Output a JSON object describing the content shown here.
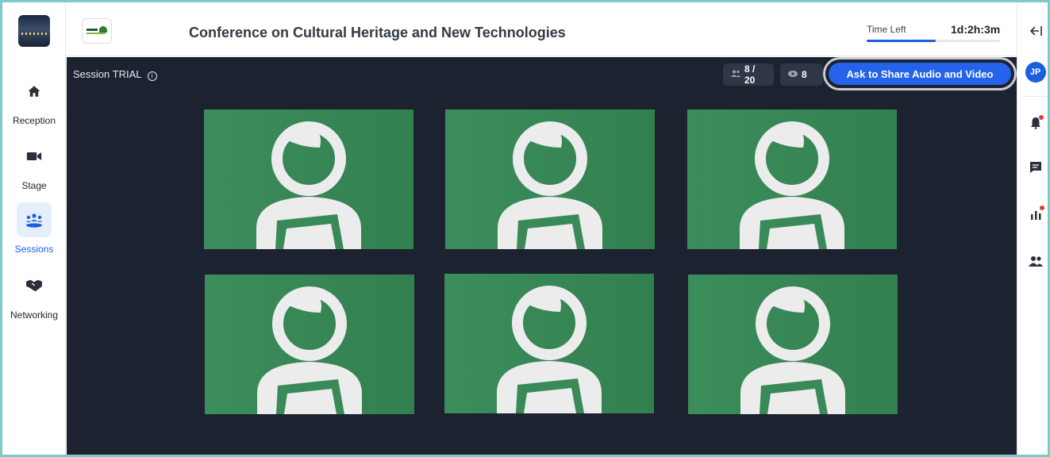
{
  "header": {
    "title": "Conference on Cultural Heritage and New Technologies",
    "time_left_label": "Time Left",
    "time_left_value": "1d:2h:3m",
    "time_progress": 0.52
  },
  "sidebar": {
    "items": [
      {
        "label": "Reception",
        "icon": "home-icon"
      },
      {
        "label": "Stage",
        "icon": "video-camera-icon"
      },
      {
        "label": "Sessions",
        "icon": "people-group-icon",
        "active": true
      },
      {
        "label": "Networking",
        "icon": "handshake-icon"
      }
    ]
  },
  "session": {
    "title": "Session TRIAL",
    "participants": "8 / 20",
    "viewers": "8",
    "share_button": "Ask to Share Audio and Video"
  },
  "rail": {
    "avatar_initials": "JP",
    "icons": [
      "collapse-arrow-icon",
      "bell-icon",
      "chat-icon",
      "poll-chart-icon",
      "people-icon"
    ]
  },
  "colors": {
    "accent": "#2563eb",
    "stage_bg": "#1c2230",
    "tile_green": "#3a8a59",
    "notification_dot": "#e53935"
  }
}
